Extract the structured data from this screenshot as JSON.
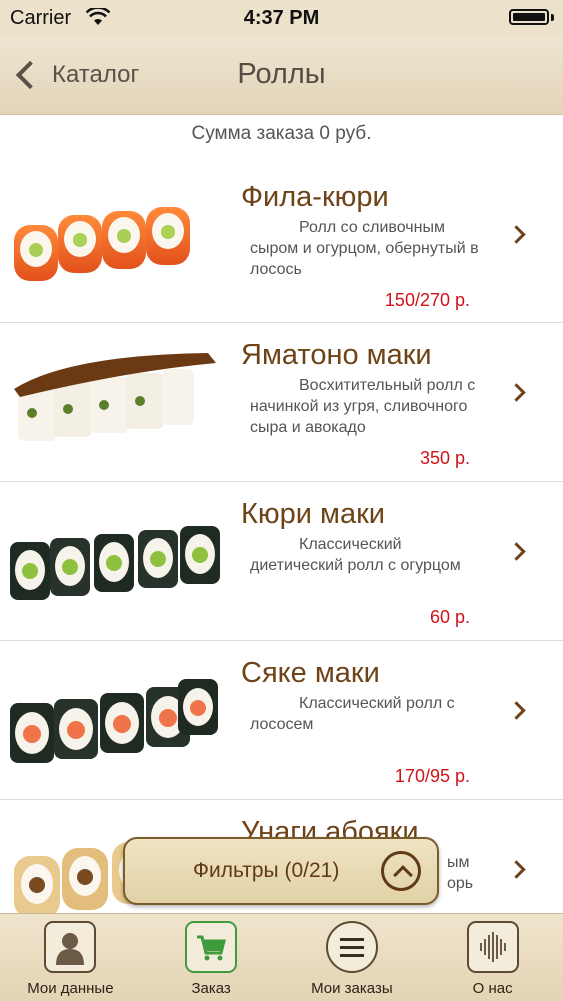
{
  "status_bar": {
    "carrier": "Carrier",
    "time": "4:37 PM"
  },
  "nav": {
    "back_label": "Каталог",
    "title": "Роллы"
  },
  "order": {
    "sum_text": "Сумма заказа 0 руб."
  },
  "items": [
    {
      "name": "Фила-кюри",
      "description": "Ролл со сливочным сыром и огурцом, обернутый в лосось",
      "price": "150/270 р."
    },
    {
      "name": "Яматоно маки",
      "description": "Восхитительный ролл с начинкой из угря, сливочного сыра и авокадо",
      "price": "350 р."
    },
    {
      "name": "Кюри маки",
      "description": "Классический диетический ролл с огурцом",
      "price": "60 р."
    },
    {
      "name": "Сяке маки",
      "description": "Классический ролл с лососем",
      "price": "170/95 р."
    },
    {
      "name": "Унаги абояки",
      "description": "ым орь",
      "price": ""
    }
  ],
  "filter": {
    "label": "Фильтры (0/21)"
  },
  "tabs": [
    {
      "label": "Мои данные",
      "icon": "person-icon"
    },
    {
      "label": "Заказ",
      "icon": "cart-icon",
      "active": true
    },
    {
      "label": "Мои заказы",
      "icon": "list-icon"
    },
    {
      "label": "О нас",
      "icon": "info-icon"
    }
  ],
  "colors": {
    "accent_brown": "#6e4318",
    "price_red": "#d0121b",
    "active_tab": "#3f9b3c"
  }
}
